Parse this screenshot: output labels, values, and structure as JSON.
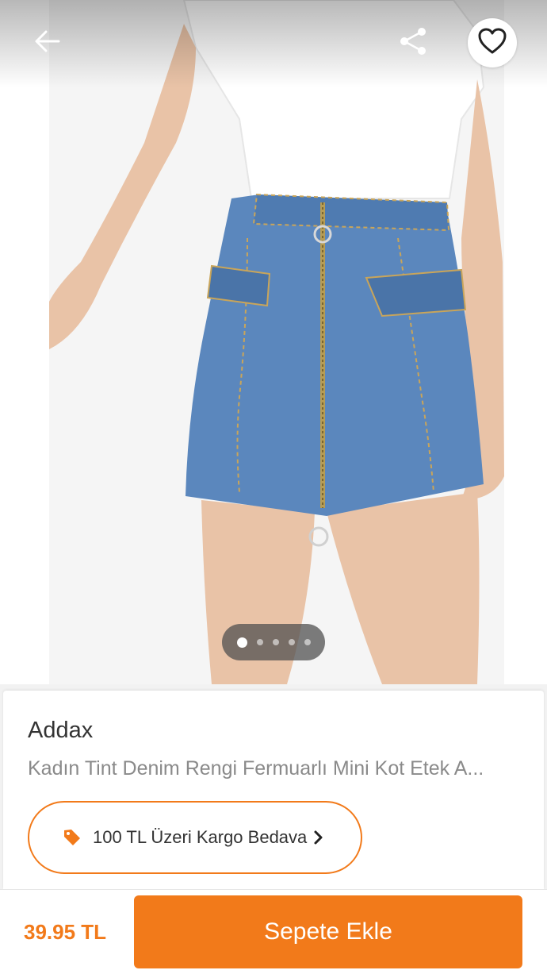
{
  "header": {
    "back_icon": "arrow-left-icon",
    "share_icon": "share-icon",
    "favorite_icon": "heart-outline-icon"
  },
  "gallery": {
    "image_count": 5,
    "active_index": 0
  },
  "product": {
    "brand": "Addax",
    "name": "Kadın Tint Denim Rengi Fermuarlı Mini Kot Etek A...",
    "shipping_badge": {
      "icon": "tag-icon",
      "text": "100 TL Üzeri Kargo Bedava",
      "chevron_icon": "chevron-right-icon"
    }
  },
  "footer": {
    "price": "39.95 TL",
    "add_to_cart_label": "Sepete Ekle"
  },
  "colors": {
    "accent": "#f27a1a",
    "text_primary": "#333333",
    "text_secondary": "#8a8a8a"
  }
}
